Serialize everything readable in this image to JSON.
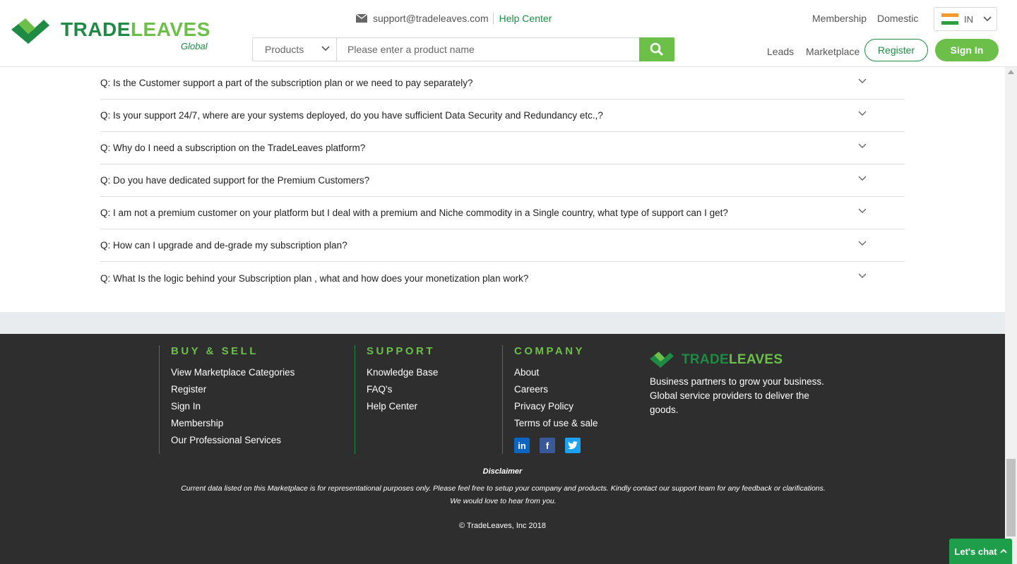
{
  "header": {
    "logo_part1": "TRADE",
    "logo_part2": "LEAVES",
    "logo_sub": "Global",
    "support_email": "support@tradeleaves.com",
    "help_center": "Help Center",
    "search_category": "Products",
    "search_placeholder": "Please enter a product name",
    "membership": "Membership",
    "domestic": "Domestic",
    "country": "IN",
    "leads": "Leads",
    "marketplace": "Marketplace",
    "register": "Register",
    "sign_in": "Sign In"
  },
  "faq": [
    "Q: Is the Customer support a part of the subscription plan or we need to pay separately?",
    "Q: Is your support 24/7, where are your systems deployed, do you have sufficient Data Security and Redundancy etc.,?",
    "Q: Why do I need a subscription on the TradeLeaves platform?",
    "Q: Do you have dedicated support for the Premium Customers?",
    "Q: I am not a premium customer on your platform but I deal with a premium and Niche commodity in a Single country, what type of support can I get?",
    "Q: How can I upgrade and de-grade my subscription plan?",
    "Q: What Is the logic behind your Subscription plan , what and how does your monetization plan work?"
  ],
  "footer": {
    "buy_sell": {
      "title": "BUY & SELL",
      "links": [
        "View Marketplace Categories",
        "Register",
        "Sign In",
        "Membership",
        "Our Professional Services"
      ]
    },
    "support": {
      "title": "SUPPORT",
      "links": [
        "Knowledge Base",
        "FAQ's",
        "Help Center"
      ]
    },
    "company": {
      "title": "COMPANY",
      "links": [
        "About",
        "Careers",
        "Privacy Policy",
        "Terms of use & sale"
      ]
    },
    "logo_part1": "TRADE",
    "logo_part2": "LEAVES",
    "description": "Business partners to grow your business. Global service providers to deliver the goods.",
    "disclaimer_title": "Disclaimer",
    "disclaimer": "Current data listed on this Marketplace is for representational purposes only. Please feel free to setup your company and products. Kindly contact our support team for any feedback or clarifications. We would love to hear from you.",
    "copyright": "© TradeLeaves, Inc 2018"
  },
  "chat_label": "Let's chat",
  "colors": {
    "brand_dark_green": "#1e8a44",
    "brand_light_green": "#6cc04a",
    "footer_bg": "#2e2e2e"
  }
}
